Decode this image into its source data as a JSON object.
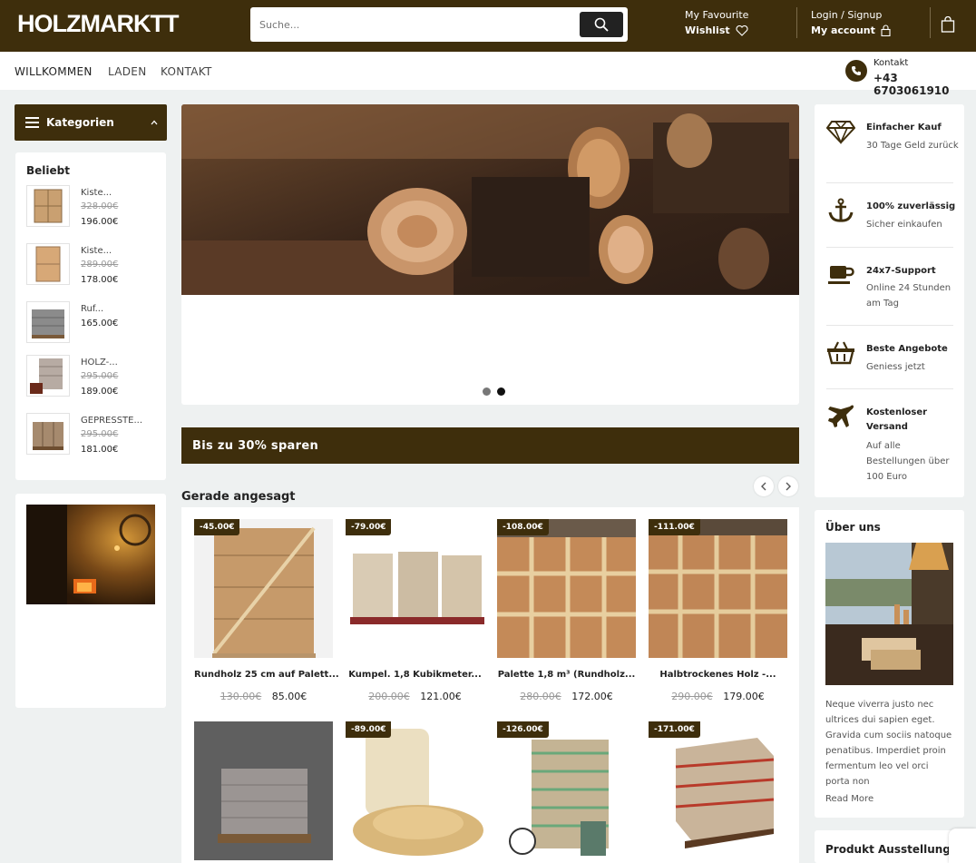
{
  "header": {
    "logo": "HOLZMARKTT",
    "search_placeholder": "Suche...",
    "favourite_label": "My Favourite",
    "wishlist_label": "Wishlist",
    "login_label": "Login / Signup",
    "account_label": "My account"
  },
  "nav": {
    "items": [
      {
        "label": "WILLKOMMEN"
      },
      {
        "label": "LADEN"
      },
      {
        "label": "KONTAKT"
      }
    ],
    "contact_label": "Kontakt",
    "contact_number": "+43 6703061910"
  },
  "sidebar": {
    "categories_label": "Kategorien",
    "popular_title": "Beliebt",
    "popular": [
      {
        "name": "Kiste...",
        "old_price": "328.00€",
        "price": "196.00€"
      },
      {
        "name": "Kiste...",
        "old_price": "289.00€",
        "price": "178.00€"
      },
      {
        "name": "Ruf...",
        "old_price": "",
        "price": "165.00€"
      },
      {
        "name": "HOLZ-...",
        "old_price": "295.00€",
        "price": "189.00€"
      },
      {
        "name": "GEPRESSTE...",
        "old_price": "295.00€",
        "price": "181.00€"
      }
    ]
  },
  "promo": {
    "text": "Bis zu 30% sparen"
  },
  "trending": {
    "title": "Gerade angesagt",
    "products": [
      {
        "badge": "-45.00€",
        "name": "Rundholz 25 cm auf Palett...",
        "old_price": "130.00€",
        "price": "85.00€"
      },
      {
        "badge": "-79.00€",
        "name": "Kumpel. 1,8 Kubikmeter...",
        "old_price": "200.00€",
        "price": "121.00€"
      },
      {
        "badge": "-108.00€",
        "name": "Palette 1,8 m³ (Rundholz...",
        "old_price": "280.00€",
        "price": "172.00€"
      },
      {
        "badge": "-111.00€",
        "name": "Halbtrockenes Holz -...",
        "old_price": "290.00€",
        "price": "179.00€"
      },
      {
        "badge": "",
        "name": "",
        "old_price": "",
        "price": ""
      },
      {
        "badge": "-89.00€",
        "name": "",
        "old_price": "",
        "price": ""
      },
      {
        "badge": "-126.00€",
        "name": "",
        "old_price": "",
        "price": ""
      },
      {
        "badge": "-171.00€",
        "name": "",
        "old_price": "",
        "price": ""
      }
    ]
  },
  "features": [
    {
      "icon": "diamond-icon",
      "title": "Einfacher Kauf",
      "text": "30 Tage Geld zurück"
    },
    {
      "icon": "anchor-icon",
      "title": "100% zuverlässig",
      "text": "Sicher einkaufen"
    },
    {
      "icon": "cup-icon",
      "title": "24x7-Support",
      "text": "Online 24 Stunden am Tag"
    },
    {
      "icon": "basket-icon",
      "title": "Beste Angebote",
      "text": "Geniess jetzt"
    },
    {
      "icon": "plane-icon",
      "title": "Kostenloser Versand",
      "text": "Auf alle Bestellungen über 100 Euro"
    }
  ],
  "about": {
    "title": "Über uns",
    "text": "Neque viverra justo nec ultrices dui sapien eget. Gravida cum sociis natoque penatibus. Imperdiet proin fermentum leo vel orci porta non",
    "read_more": "Read More"
  },
  "exhibition": {
    "title": "Produkt Ausstellung"
  },
  "colors": {
    "brand": "#3e2e0c",
    "background": "#eef1f1"
  }
}
